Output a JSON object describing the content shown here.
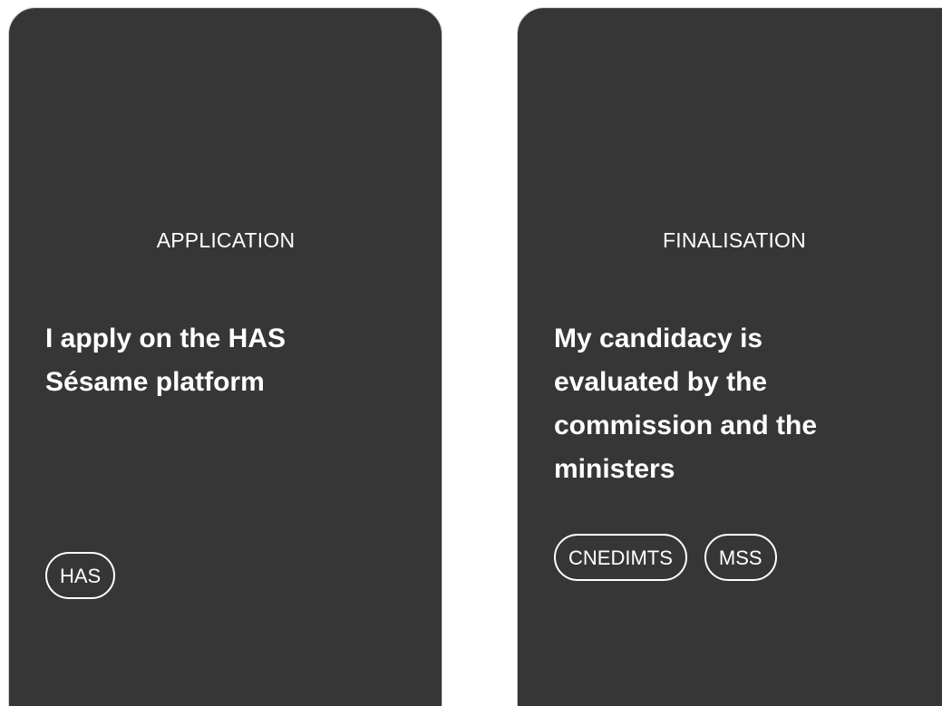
{
  "cards": [
    {
      "step": "APPLICATION",
      "headline": "I apply on the HAS Sésame platform",
      "tags": [
        "HAS"
      ]
    },
    {
      "step": "FINALISATION",
      "headline": "My candidacy is evaluated by the commission and the ministers",
      "tags": [
        "CNEDIMTS",
        "MSS"
      ]
    }
  ],
  "colors": {
    "card_background": "#363636",
    "text": "#ffffff",
    "card_border": "#cfcfcf",
    "page_background": "#ffffff"
  }
}
